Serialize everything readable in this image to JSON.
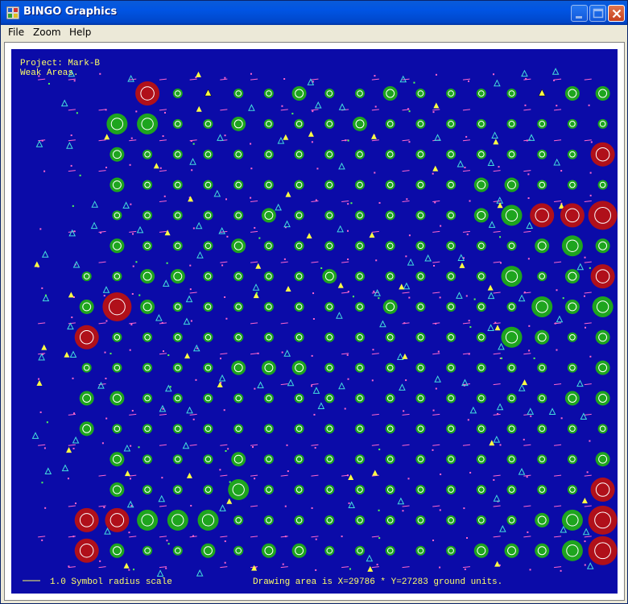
{
  "window": {
    "title": "BINGO Graphics",
    "buttons": {
      "minimize": "minimize",
      "maximize": "maximize",
      "close": "close"
    }
  },
  "menu": {
    "items": [
      "File",
      "Zoom",
      "Help"
    ]
  },
  "plot": {
    "project_label": "Project: Mark-B",
    "subtitle": "Weak Areas.",
    "scale_label": "1.0 Symbol radius scale",
    "drawing_area_label": "Drawing area is X=29786 * Y=27283 ground units.",
    "colors": {
      "background": "#0b0ba8",
      "green": "#1ea51e",
      "red": "#b0101a",
      "ring": "#ffffff",
      "marker": "#ff66cc",
      "triangle_cyan": "#44dddd",
      "triangle_yellow": "#ffff44",
      "text": "#ffff66"
    },
    "grid": {
      "cols": 18,
      "rows": 16,
      "rows_data": [
        {
          "start": 3,
          "sizes": [
            "r3",
            "g1",
            "t",
            "g1",
            "g1",
            "g2",
            "g1",
            "g1",
            "g2",
            "g1",
            "g1",
            "g1",
            "g1",
            "t",
            "g2",
            "g2",
            "r3"
          ]
        },
        {
          "start": 2,
          "sizes": [
            "g3",
            "g3",
            "g1",
            "g1",
            "g2",
            "g1",
            "g1",
            "g1",
            "g2",
            "g1",
            "g1",
            "g1",
            "g1",
            "g1",
            "g1",
            "g1",
            "g1",
            "g3"
          ]
        },
        {
          "start": 2,
          "sizes": [
            "g2",
            "g1",
            "g1",
            "g1",
            "g1",
            "g1",
            "g1",
            "g1",
            "g1",
            "g1",
            "g1",
            "g1",
            "g1",
            "g1",
            "g1",
            "g1",
            "r3"
          ]
        },
        {
          "start": 2,
          "sizes": [
            "g2",
            "g1",
            "g1",
            "g1",
            "g1",
            "g1",
            "g1",
            "g1",
            "g1",
            "g1",
            "g1",
            "g1",
            "g2",
            "g2",
            "g1",
            "g1",
            "g1",
            "g1"
          ]
        },
        {
          "start": 2,
          "sizes": [
            "g1",
            "g1",
            "g1",
            "g1",
            "g1",
            "g2",
            "g1",
            "g1",
            "g1",
            "g1",
            "g1",
            "g1",
            "g2",
            "g3",
            "r3",
            "r3",
            "r4"
          ]
        },
        {
          "start": 2,
          "sizes": [
            "g2",
            "g1",
            "g1",
            "g1",
            "g2",
            "g1",
            "g1",
            "g1",
            "g1",
            "g1",
            "g1",
            "g1",
            "g1",
            "g1",
            "g2",
            "g3",
            "g2",
            "r3"
          ]
        },
        {
          "start": 1,
          "sizes": [
            "g1",
            "g1",
            "g2",
            "g2",
            "g1",
            "g1",
            "g1",
            "g1",
            "g2",
            "g1",
            "g1",
            "g1",
            "g1",
            "g1",
            "g3",
            "g1",
            "g2",
            "r3"
          ]
        },
        {
          "start": 1,
          "sizes": [
            "g2",
            "r4",
            "g2",
            "g1",
            "g1",
            "g1",
            "g1",
            "g1",
            "g1",
            "g1",
            "g2",
            "g1",
            "g1",
            "g1",
            "g1",
            "g3",
            "g2",
            "g3"
          ]
        },
        {
          "start": 1,
          "sizes": [
            "r3",
            "g1",
            "g1",
            "g1",
            "g1",
            "g1",
            "g1",
            "g1",
            "g1",
            "g1",
            "g1",
            "g1",
            "g1",
            "g1",
            "g3",
            "g2",
            "g1",
            "g2"
          ]
        },
        {
          "start": 1,
          "sizes": [
            "g1",
            "g1",
            "g1",
            "g1",
            "g1",
            "g2",
            "g2",
            "g2",
            "g1",
            "g1",
            "g1",
            "g1",
            "g1",
            "g1",
            "g1",
            "g1",
            "g1",
            "g2"
          ]
        },
        {
          "start": 1,
          "sizes": [
            "g2",
            "g2",
            "g1",
            "g1",
            "g1",
            "g1",
            "g1",
            "g1",
            "g1",
            "g1",
            "g1",
            "g1",
            "g1",
            "g1",
            "g1",
            "g1",
            "g2",
            "g2"
          ]
        },
        {
          "start": 1,
          "sizes": [
            "g2",
            "g1",
            "g1",
            "g1",
            "g1",
            "g1",
            "g1",
            "g1",
            "g1",
            "g1",
            "g1",
            "g1",
            "g1",
            "g1",
            "g1",
            "g1",
            "g1",
            "g1"
          ]
        },
        {
          "start": 2,
          "sizes": [
            "g2",
            "g1",
            "g1",
            "g1",
            "g2",
            "g1",
            "g1",
            "g1",
            "g1",
            "g1",
            "g1",
            "g1",
            "g1",
            "g1",
            "g1",
            "g1",
            "g2"
          ]
        },
        {
          "start": 2,
          "sizes": [
            "g2",
            "g1",
            "g1",
            "g1",
            "g3",
            "g1",
            "g1",
            "g1",
            "g1",
            "g1",
            "g1",
            "g1",
            "g1",
            "g1",
            "g1",
            "g1",
            "r3"
          ]
        },
        {
          "start": 1,
          "sizes": [
            "r3",
            "r3",
            "g3",
            "g3",
            "g3",
            "g1",
            "g1",
            "g1",
            "g1",
            "g1",
            "g1",
            "g1",
            "g1",
            "g1",
            "g1",
            "g2",
            "g3",
            "r4"
          ]
        },
        {
          "start": 1,
          "sizes": [
            "r3",
            "g2",
            "g1",
            "g1",
            "g2",
            "g1",
            "g2",
            "g2",
            "g1",
            "g1",
            "g1",
            "g1",
            "g1",
            "g2",
            "g2",
            "g2",
            "g3",
            "r4"
          ]
        }
      ]
    }
  }
}
